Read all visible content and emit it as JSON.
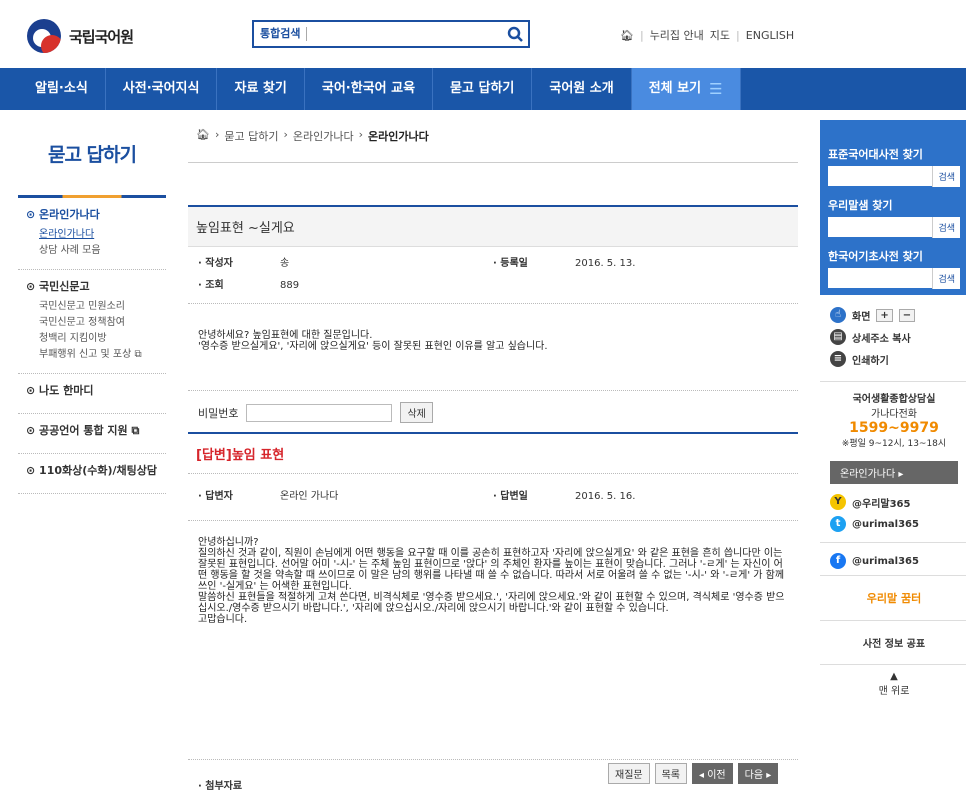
{
  "header": {
    "logo": "국립국어원",
    "search_label": "통합검색",
    "links": [
      "누리집 안내",
      "지도",
      "ENGLISH"
    ]
  },
  "nav": [
    "알림·소식",
    "사전·국어지식",
    "자료 찾기",
    "국어·한국어 교육",
    "묻고 답하기",
    "국어원 소개"
  ],
  "nav_all": "전체 보기",
  "sidebar": {
    "title": "묻고 답하기",
    "groups": [
      {
        "title": "온라인가나다",
        "items": [
          "온라인가나다",
          "상담 사례 모음"
        ]
      },
      {
        "title": "국민신문고",
        "items": [
          "국민신문고 민원소리",
          "국민신문고 정책참여",
          "청백리 지킴이방",
          "부패행위 신고 및 포상"
        ]
      },
      {
        "title": "나도 한마디",
        "items": []
      },
      {
        "title": "공공언어 통합 지원",
        "items": []
      },
      {
        "title": "110화상(수화)/채팅상담",
        "items": []
      }
    ]
  },
  "breadcrumb": [
    "묻고 답하기",
    "온라인가나다",
    "온라인가나다"
  ],
  "question": {
    "title": "높임표현 ~실게요",
    "author_label": "작성자",
    "author": "송",
    "date_label": "등록일",
    "date": "2016. 5. 13.",
    "views_label": "조회",
    "views": "889",
    "body": "안녕하세요? 높임표현에 대한 질문입니다.\n'영수증 받으실게요', '자리에 앉으실게요' 등이 잘못된 표현인 이유를 알고 싶습니다."
  },
  "password": {
    "label": "비밀번호",
    "delete": "삭제"
  },
  "answer": {
    "tag": "[답변]",
    "title": "높임 표현",
    "author_label": "답변자",
    "author": "온라인 가나다",
    "date_label": "답변일",
    "date": "2016. 5. 16.",
    "body": "안녕하십니까?\n질의하신 것과 같이, 직원이 손님에게 어떤 행동을 요구할 때 이를 공손히 표현하고자 '자리에 앉으실게요' 와 같은 표현을 흔히 씁니다만 이는 잘못된 표현입니다. 선어말 어미 '-시-' 는 주체 높임 표현이므로 '앉다' 의 주체인 환자를 높이는 표현이 맞습니다. 그러나 '-ㄹ게' 는 자신이 어떤 행동을 할 것을 약속할 때 쓰이므로 이 말은 남의 행위를 나타낼 때 쓸 수 없습니다. 따라서 서로 어울려 쓸 수 없는 '-시-' 와 '-ㄹ게' 가 함께 쓰인 '-실게요' 는 어색한 표현입니다.\n말씀하신 표현들을 적절하게 고쳐 쓴다면, 비격식체로 '영수증 받으세요.', '자리에 앉으세요.'와 같이 표현할 수 있으며, 격식체로 '영수증 받으십시오./영수증 받으시기 바랍니다.', '자리에 앉으십시오./자리에 앉으시기 바랍니다.'와 같이 표현할 수 있습니다.\n고맙습니다.",
    "attach": "첨부자료"
  },
  "buttons": [
    "재질문",
    "목록",
    "◂ 이전",
    "다음 ▸"
  ],
  "right": {
    "dict": [
      "표준국어대사전 찾기",
      "우리말샘 찾기",
      "한국어기초사전 찾기"
    ],
    "search": "검색",
    "tools": [
      "화면",
      "상세주소 복사",
      "인쇄하기"
    ],
    "center": "국어생활종합상담실",
    "phone_label": "가나다전화",
    "phone": "1599~9979",
    "hours": "※평일 9~12시, 13~18시",
    "online": "온라인가나다",
    "sns": [
      "@우리말365",
      "@urimal365",
      "@urimal365"
    ],
    "kkumter": "우리말 꿈터",
    "pub": "사전 정보 공표",
    "top": "맨 위로"
  }
}
